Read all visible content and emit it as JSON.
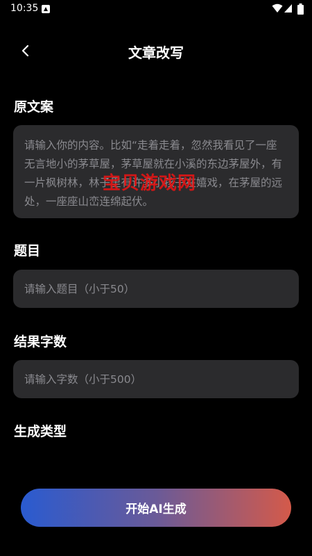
{
  "status_bar": {
    "time": "10:35",
    "app_icon": "notification-app-icon",
    "icons": [
      "wifi-icon",
      "signal-icon",
      "battery-icon"
    ]
  },
  "header": {
    "title": "文章改写",
    "back_icon": "chevron-left-icon"
  },
  "form": {
    "original_text": {
      "label": "原文案",
      "placeholder": "请输入你的内容。比如“走着走着，忽然我看见了一座无言地小的茅草屋，茅草屋就在小溪的东边茅屋外，有一片枫树林，林子里有许多小孩子在嬉戏，在茅屋的远处，一座座山峦连绵起伏。"
    },
    "title": {
      "label": "题目",
      "placeholder": "请输入题目（小于50）"
    },
    "word_count": {
      "label": "结果字数",
      "placeholder": "请输入字数（小于500）"
    },
    "generate_type": {
      "label": "生成类型"
    }
  },
  "watermark": "宝贝游戏网",
  "generate_button": {
    "label": "开始AI生成"
  },
  "colors": {
    "background": "#000000",
    "field_background": "#2b2b2d",
    "placeholder": "#8a8a8f",
    "button_gradient_start": "#2a5bd0",
    "button_gradient_end": "#d45a4a",
    "watermark": "#e61414"
  }
}
